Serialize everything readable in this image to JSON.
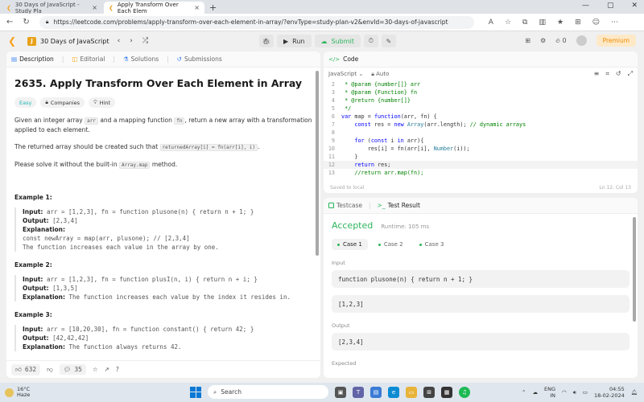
{
  "browser": {
    "tabs": [
      {
        "title": "30 Days of JavaScript - Study Pla",
        "active": false
      },
      {
        "title": "Apply Transform Over Each Elem",
        "active": true
      }
    ],
    "url": "https://leetcode.com/problems/apply-transform-over-each-element-in-array/?envType=study-plan-v2&envId=30-days-of-javascript"
  },
  "header": {
    "study_plan": "30 Days of JavaScript",
    "run_label": "Run",
    "submit_label": "Submit",
    "streak": "0",
    "premium_label": "Premium"
  },
  "left_tabs": [
    "Description",
    "Editorial",
    "Solutions",
    "Submissions"
  ],
  "problem": {
    "title": "2635. Apply Transform Over Each Element in Array",
    "tags": [
      "Easy",
      "Companies",
      "Hint"
    ],
    "desc1_a": "Given an integer array ",
    "desc1_code1": "arr",
    "desc1_b": " and a mapping function ",
    "desc1_code2": "fn",
    "desc1_c": ", return a new array with a transformation applied to each element.",
    "desc2_a": "The returned array should be created such that ",
    "desc2_code": "returnedArray[i] = fn(arr[i], i)",
    "desc2_b": ".",
    "desc3_a": "Please solve it without the built-in ",
    "desc3_code": "Array.map",
    "desc3_b": " method."
  },
  "examples": [
    {
      "title": "Example 1:",
      "input": "arr = [1,2,3], fn = function plusone(n) { return n + 1; }",
      "output": "[2,3,4]",
      "explanation_label": "Explanation:",
      "extra": [
        "const newArray = map(arr, plusone); // [2,3,4]",
        "The function increases each value in the array by one."
      ]
    },
    {
      "title": "Example 2:",
      "input": "arr = [1,2,3], fn = function plusI(n, i) { return n + i; }",
      "output": "[1,3,5]",
      "explanation_label": "Explanation:",
      "explanation": "The function increases each value by the index it resides in."
    },
    {
      "title": "Example 3:",
      "input": "arr = [10,20,30], fn = function constant() { return 42; }",
      "output": "[42,42,42]",
      "explanation_label": "Explanation:",
      "explanation": "The function always returns 42."
    }
  ],
  "labels": {
    "input": "Input:",
    "output": "Output:"
  },
  "footer": {
    "likes": "632",
    "comments": "35"
  },
  "code_panel": {
    "title": "Code",
    "language": "JavaScript",
    "mode": "Auto",
    "status_left": "Saved to local",
    "status_right": "Ln 12, Col 13"
  },
  "result_panel": {
    "tabs": [
      "Testcase",
      "Test Result"
    ],
    "status": "Accepted",
    "runtime": "Runtime: 105 ms",
    "cases": [
      "Case 1",
      "Case 2",
      "Case 3"
    ],
    "input_label": "Input",
    "input_value": "function plusone(n) { return n + 1; }",
    "input_value2": "[1,2,3]",
    "output_label": "Output",
    "output_value": "[2,3,4]",
    "expected_label": "Expected"
  },
  "taskbar": {
    "temp": "16°C",
    "weather": "Haze",
    "search": "Search",
    "lang1": "ENG",
    "lang2": "IN",
    "time": "04:55",
    "date": "18-02-2024"
  }
}
